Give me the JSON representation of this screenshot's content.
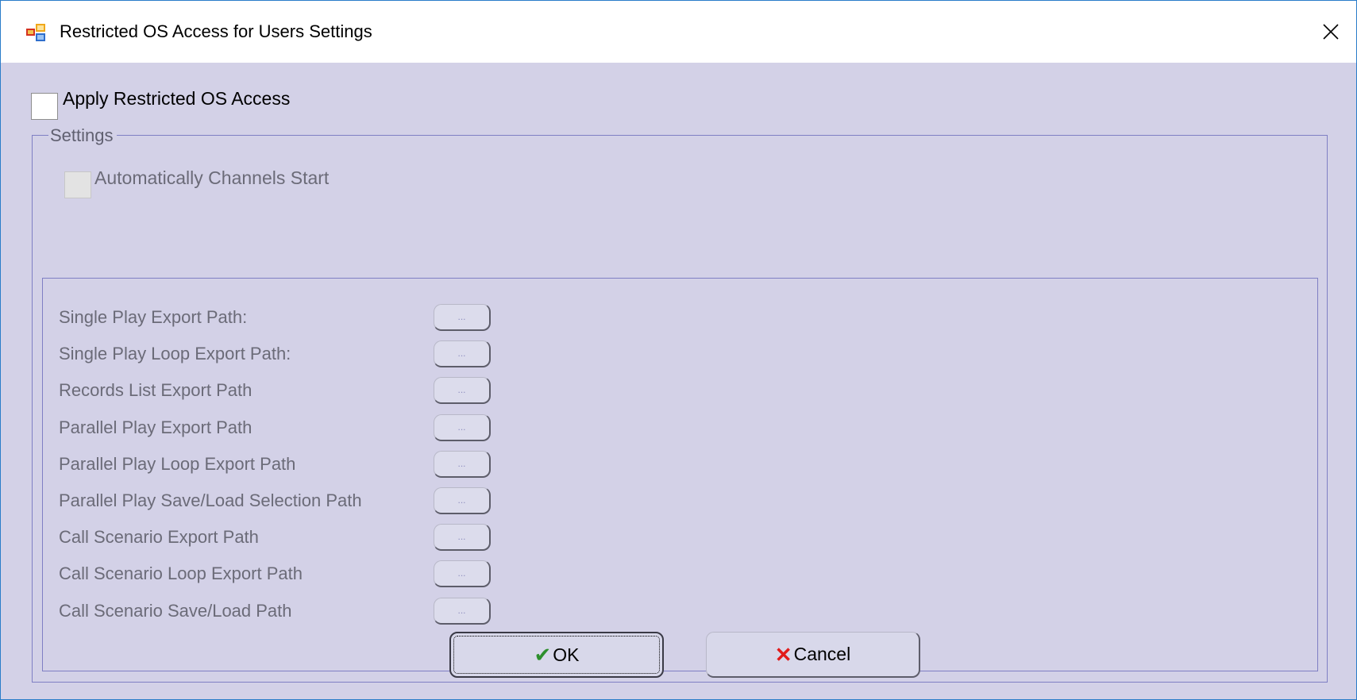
{
  "window": {
    "title": "Restricted OS Access for Users Settings",
    "icon": "app-window-icon",
    "close_glyph": "✕"
  },
  "apply": {
    "label": "Apply Restricted OS Access",
    "checked": false
  },
  "settings": {
    "legend": "Settings",
    "auto_start": {
      "label": "Automatically Channels Start",
      "checked": false,
      "enabled": false
    },
    "paths": [
      {
        "label": "Single Play Export Path:",
        "button": "..."
      },
      {
        "label": "Single Play Loop Export Path:",
        "button": "..."
      },
      {
        "label": "Records List Export Path",
        "button": "..."
      },
      {
        "label": "Parallel Play Export Path",
        "button": "..."
      },
      {
        "label": "Parallel Play Loop Export Path",
        "button": "..."
      },
      {
        "label": "Parallel Play Save/Load Selection Path",
        "button": "..."
      },
      {
        "label": "Call Scenario Export Path",
        "button": "..."
      },
      {
        "label": "Call Scenario Loop Export Path",
        "button": "..."
      },
      {
        "label": "Call Scenario Save/Load Path",
        "button": "..."
      }
    ]
  },
  "buttons": {
    "ok": {
      "label": "OK",
      "icon": "check-icon",
      "icon_glyph": "✔"
    },
    "cancel": {
      "label": "Cancel",
      "icon": "x-icon",
      "icon_glyph": "✕"
    }
  },
  "colors": {
    "window_bg": "#d3d1e7",
    "group_border": "#7f7fc4",
    "ok_icon": "#2d8f2d",
    "cancel_icon": "#e21b1b"
  }
}
